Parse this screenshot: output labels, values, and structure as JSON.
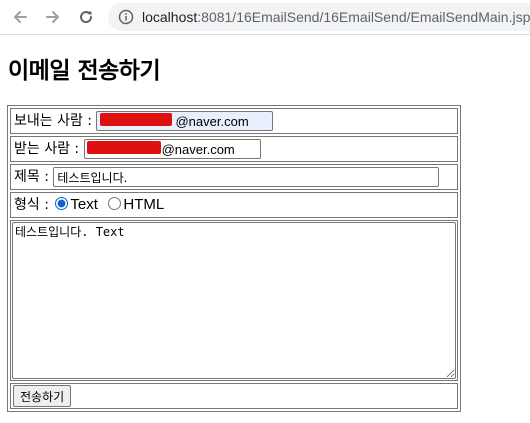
{
  "browser": {
    "url_host": "localhost",
    "url_path": ":8081/16EmailSend/16EmailSend/EmailSendMain.jsp",
    "icons": {
      "back": "arrow-left-icon",
      "forward": "arrow-right-icon",
      "reload": "reload-icon",
      "info": "info-icon"
    }
  },
  "page": {
    "title": "이메일 전송하기"
  },
  "form": {
    "sender": {
      "label": "보내는 사람 :",
      "value": "@naver.com"
    },
    "receiver": {
      "label": "받는 사람 :",
      "value": "@naver.com"
    },
    "subject": {
      "label": "제목 :",
      "value": "테스트입니다."
    },
    "format": {
      "label": "형식 :",
      "options": [
        "Text",
        "HTML"
      ],
      "selected": "Text"
    },
    "body": {
      "value": "테스트입니다. Text"
    },
    "submit_label": "전송하기"
  },
  "colors": {
    "redaction": "#e01010",
    "radio_accent": "#0b63d6",
    "sender_autofill_bg": "#e8f0fe"
  }
}
